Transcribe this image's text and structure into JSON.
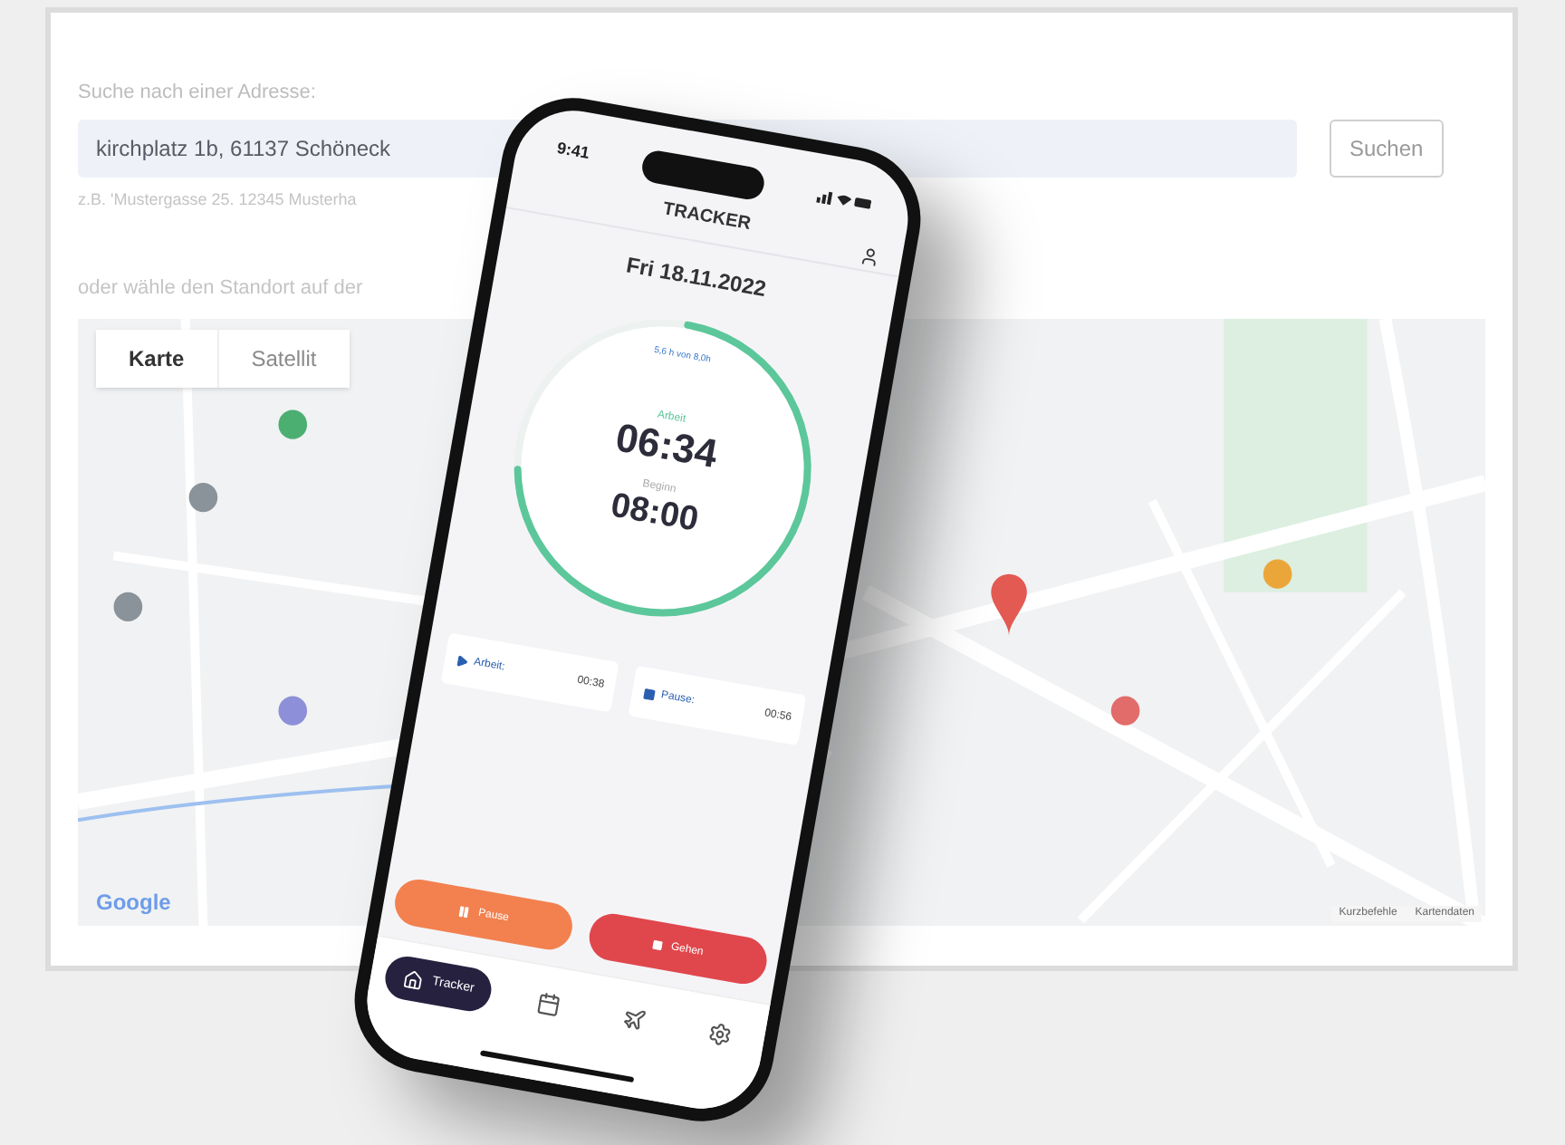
{
  "page": {
    "search_label": "Suche nach einer Adresse:",
    "search_value": "kirchplatz 1b, 61137 Schöneck",
    "search_button": "Suchen",
    "search_hint": "z.B. 'Mustergasse 25. 12345 Musterha",
    "map_prompt": "oder wähle den Standort auf der"
  },
  "map": {
    "types": [
      {
        "label": "Karte",
        "selected": true
      },
      {
        "label": "Satellit",
        "selected": false
      }
    ],
    "logo": "Google",
    "footer_links": [
      "Kurzbefehle",
      "Kartendaten"
    ]
  },
  "phone": {
    "status_time": "9:41",
    "title": "TRACKER",
    "date": "Fri 18.11.2022",
    "ring": {
      "caption": "5,6 h von 8,0h",
      "level": 0.72,
      "work_label": "Arbeit",
      "work_time": "06:34",
      "start_label": "Beginn",
      "start_time": "08:00"
    },
    "stats": [
      {
        "kind": "play",
        "label": "Arbeit:",
        "value": "00:38"
      },
      {
        "kind": "stop",
        "label": "Pause:",
        "value": "00:56"
      }
    ],
    "actions": [
      {
        "kind": "pause",
        "label": "Pause"
      },
      {
        "kind": "stop",
        "label": "Gehen"
      }
    ],
    "nav": [
      {
        "kind": "home",
        "label": "Tracker",
        "selected": true
      },
      {
        "kind": "calendar",
        "selected": false
      },
      {
        "kind": "plane",
        "selected": false
      },
      {
        "kind": "settings",
        "selected": false
      }
    ]
  }
}
